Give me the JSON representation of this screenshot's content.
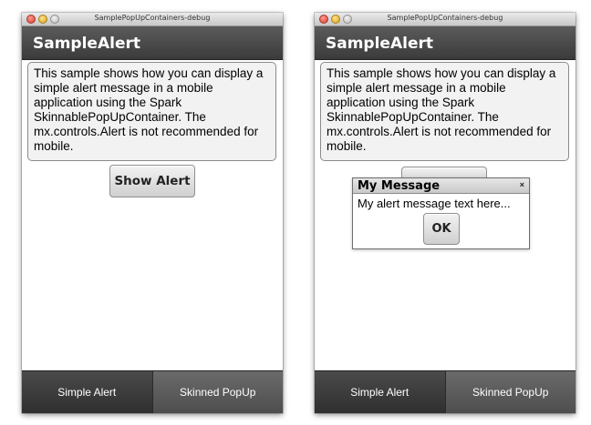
{
  "windows": [
    {
      "title": "SamplePopUpContainers-debug",
      "app_title": "SampleAlert",
      "description": "This sample shows how you can display a simple alert message in a mobile application using the Spark SkinnablePopUpContainer. The mx.controls.Alert is not recommended for mobile.",
      "show_alert_label": "Show Alert",
      "tabs": [
        {
          "label": "Simple Alert",
          "selected": true
        },
        {
          "label": "Skinned PopUp",
          "selected": false
        }
      ]
    },
    {
      "title": "SamplePopUpContainers-debug",
      "app_title": "SampleAlert",
      "description": "This sample shows how you can display a simple alert message in a mobile application using the Spark SkinnablePopUpContainer. The mx.controls.Alert is not recommended for mobile.",
      "alert": {
        "title": "My Message",
        "close_glyph": "×",
        "message": "My alert message text here...",
        "ok_label": "OK"
      },
      "tabs": [
        {
          "label": "Simple Alert",
          "selected": true
        },
        {
          "label": "Skinned PopUp",
          "selected": false
        }
      ]
    }
  ],
  "colors": {
    "action_bar": "#4a4a4a",
    "tab_selected": "#3a3a3a",
    "tab_unselected": "#5c5c5c",
    "close_red": "#e0443e",
    "minimize_yellow": "#e0a92b",
    "zoom_gray": "#bdbdbd"
  }
}
